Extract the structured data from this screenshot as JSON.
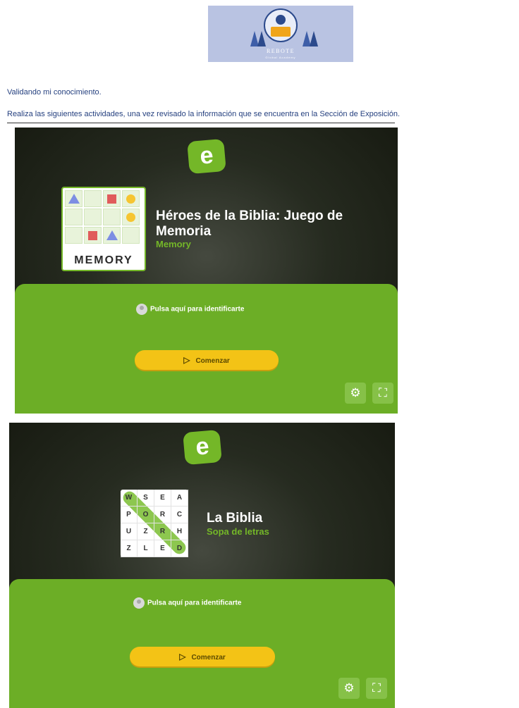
{
  "logo": {
    "title": "REBOTE",
    "subtitle": "Global Academy"
  },
  "heading": "Validando mi conocimiento.",
  "instruction": "Realiza las siguientes actividades, una vez revisado la información que se encuentra en la Sección de Exposición.",
  "activities": [
    {
      "logo_letter": "e",
      "title": "Héroes de la Biblia: Juego de Memoria",
      "kind": "Memory",
      "card_label": "MEMORY",
      "identify": "Pulsa aquí para identificarte",
      "start": "Comenzar",
      "play_icon": "▷",
      "settings_icon": "⚙",
      "fullscreen_icon": "⛶"
    },
    {
      "logo_letter": "e",
      "title": "La Biblia",
      "kind": "Sopa de letras",
      "grid": [
        "W",
        "S",
        "E",
        "A",
        "P",
        "O",
        "R",
        "C",
        "U",
        "Z",
        "R",
        "H",
        "Z",
        "L",
        "E",
        "D"
      ],
      "identify": "Pulsa aquí para identificarte",
      "start": "Comenzar",
      "play_icon": "▷",
      "settings_icon": "⚙",
      "fullscreen_icon": "⛶"
    }
  ]
}
